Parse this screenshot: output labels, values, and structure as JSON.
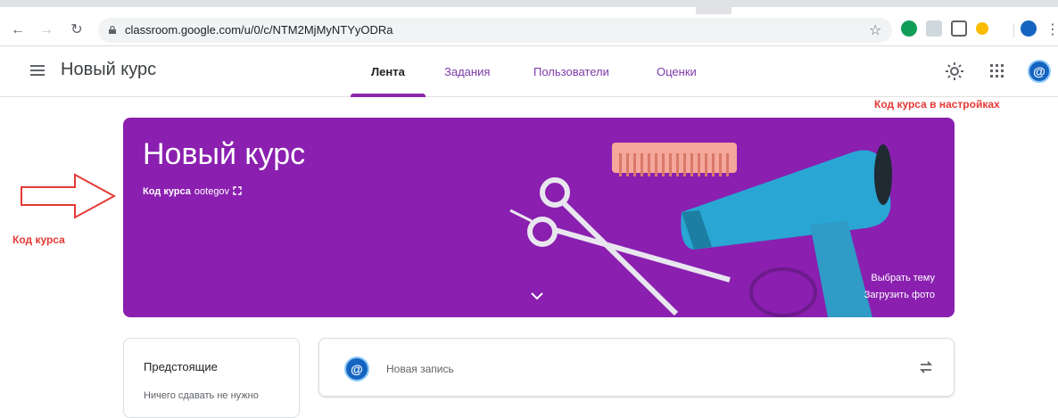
{
  "browser": {
    "url": "classroom.google.com/u/0/c/NTM2MjMyNTYyODRa",
    "back_icon": "arrow-left-icon",
    "forward_icon": "arrow-right-icon",
    "reload_icon": "reload-icon"
  },
  "header": {
    "course_title": "Новый курс",
    "tabs": [
      {
        "label": "Лента",
        "active": true
      },
      {
        "label": "Задания",
        "active": false
      },
      {
        "label": "Пользователи",
        "active": false
      },
      {
        "label": "Оценки",
        "active": false
      }
    ],
    "avatar_glyph": "@"
  },
  "annotations": {
    "settings_note": "Код курса в настройках",
    "code_note": "Код курса"
  },
  "banner": {
    "title": "Новый курс",
    "code_label": "Код курса",
    "code_value": "ootegov",
    "choose_theme": "Выбрать тему",
    "upload_photo": "Загрузить фото",
    "color": "#8a1fb0"
  },
  "upcoming": {
    "title": "Предстоящие",
    "empty_text": "Ничего сдавать не нужно"
  },
  "post": {
    "placeholder": "Новая запись",
    "avatar_glyph": "@"
  }
}
